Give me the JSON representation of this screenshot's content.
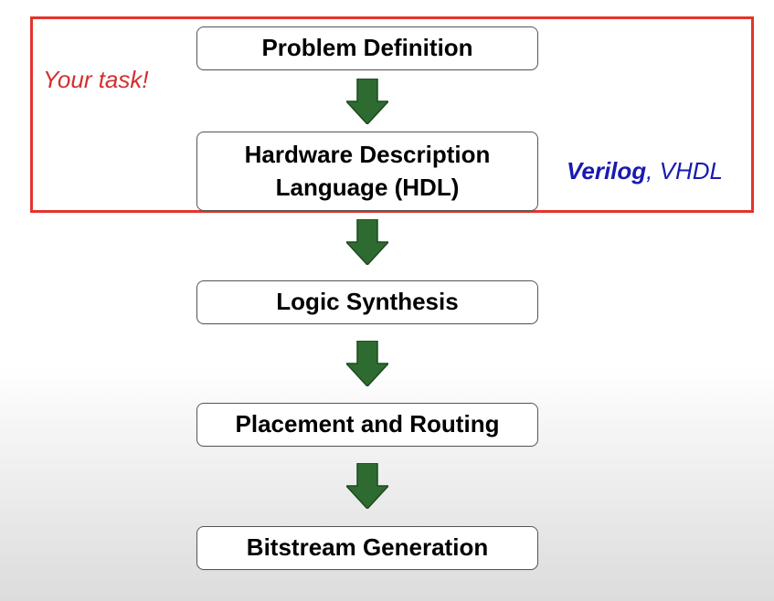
{
  "diagram": {
    "highlight": {
      "label": "Your task!",
      "border_color": "#e3342c",
      "label_color": "#d32f2f"
    },
    "languages": {
      "primary": "Verilog",
      "separator": ",",
      "secondary": " VHDL",
      "color": "#1a1ab0"
    },
    "steps": [
      {
        "label": "Problem Definition"
      },
      {
        "label": "Hardware Description Language (HDL)"
      },
      {
        "label": "Logic Synthesis"
      },
      {
        "label": "Placement and Routing"
      },
      {
        "label": "Bitstream Generation"
      }
    ],
    "arrow": {
      "icon": "down-arrow-icon",
      "fill": "#2e6b30",
      "stroke": "#1d4a1f"
    }
  }
}
